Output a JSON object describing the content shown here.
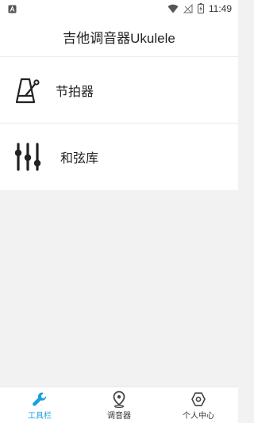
{
  "status_bar": {
    "time": "11:49",
    "notification_icon": "app-notification-icon",
    "wifi_icon": "wifi-icon",
    "signal_icon": "no-signal-icon",
    "battery_icon": "battery-charging-icon"
  },
  "header": {
    "title": "吉他调音器Ukulele"
  },
  "menu": {
    "items": [
      {
        "icon": "metronome-icon",
        "label": "节拍器"
      },
      {
        "icon": "sliders-icon",
        "label": "和弦库"
      }
    ]
  },
  "bottom_nav": {
    "active_color": "#1a9fe0",
    "items": [
      {
        "icon": "wrench-icon",
        "label": "工具栏",
        "active": true
      },
      {
        "icon": "location-pin-icon",
        "label": "调音器",
        "active": false
      },
      {
        "icon": "hexagon-icon",
        "label": "个人中心",
        "active": false
      }
    ]
  }
}
